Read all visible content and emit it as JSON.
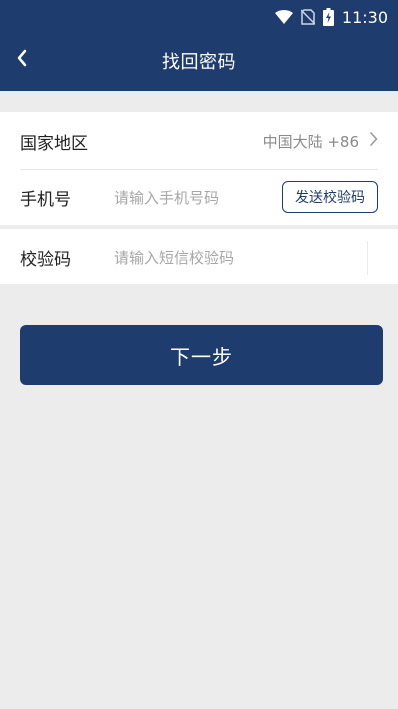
{
  "status_bar": {
    "time": "11:30",
    "icons": [
      "wifi-icon",
      "no-sim-icon",
      "battery-charging-icon"
    ]
  },
  "header": {
    "back_icon": "chevron-left-icon",
    "title": "找回密码"
  },
  "form": {
    "region": {
      "label": "国家地区",
      "value": "中国大陆 +86",
      "chevron_icon": "chevron-right-icon"
    },
    "phone": {
      "label": "手机号",
      "placeholder": "请输入手机号码",
      "send_code_label": "发送校验码"
    },
    "code": {
      "label": "校验码",
      "placeholder": "请输入短信校验码"
    }
  },
  "next_button": "下一步",
  "colors": {
    "primary": "#1f3c6e",
    "background": "#ececec",
    "card": "#ffffff"
  }
}
